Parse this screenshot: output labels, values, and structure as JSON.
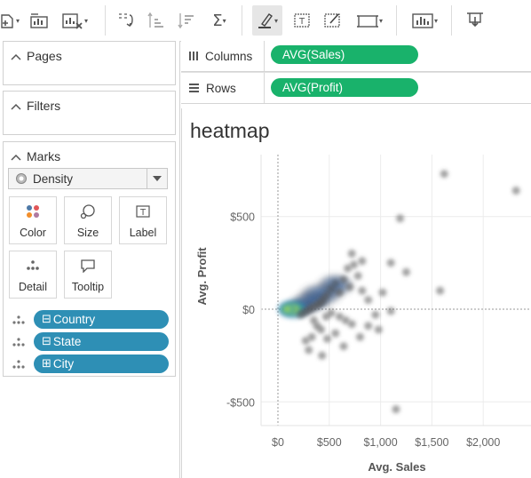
{
  "toolbar": {
    "icons": [
      "new-sheet-icon",
      "chart-icon",
      "clear-sheet-icon",
      "swap-icon",
      "sort-asc-icon",
      "sort-desc-icon",
      "totals-icon",
      "highlight-icon",
      "label-icon",
      "annotate-icon",
      "fit-icon",
      "show-me-icon",
      "presentation-icon"
    ]
  },
  "left_panel": {
    "pages_title": "Pages",
    "filters_title": "Filters",
    "marks_title": "Marks",
    "mark_type": "Density",
    "mark_buttons": [
      "Color",
      "Size",
      "Label",
      "Detail",
      "Tooltip"
    ],
    "detail_fields": [
      {
        "toggle": "⊟",
        "label": "Country"
      },
      {
        "toggle": "⊟",
        "label": "State"
      },
      {
        "toggle": "⊞",
        "label": "City"
      }
    ]
  },
  "shelves": {
    "columns_label": "Columns",
    "columns_pill": "AVG(Sales)",
    "rows_label": "Rows",
    "rows_pill": "AVG(Profit)"
  },
  "chart_data": {
    "type": "scatter",
    "title": "heatmap",
    "xlabel": "Avg. Sales",
    "ylabel": "Avg. Profit",
    "x_ticks": [
      "$0",
      "$500",
      "$1,000",
      "$1,500",
      "$2,000"
    ],
    "y_ticks": [
      "$500",
      "$0",
      "-$500"
    ],
    "xlim": [
      -150,
      2450
    ],
    "ylim": [
      -620,
      830
    ],
    "colors": {
      "density_low": "#2c6fbb",
      "density_mid": "#2aa58a",
      "density_high": "#f2f21a",
      "outlier": "#555555"
    },
    "points": [
      [
        1620,
        730
      ],
      [
        2320,
        640
      ],
      [
        1190,
        490
      ],
      [
        1100,
        250
      ],
      [
        1250,
        200
      ],
      [
        1580,
        100
      ],
      [
        820,
        260
      ],
      [
        720,
        300
      ],
      [
        740,
        240
      ],
      [
        680,
        220
      ],
      [
        780,
        180
      ],
      [
        640,
        160
      ],
      [
        700,
        120
      ],
      [
        820,
        100
      ],
      [
        600,
        90
      ],
      [
        560,
        140
      ],
      [
        520,
        110
      ],
      [
        480,
        80
      ],
      [
        450,
        60
      ],
      [
        430,
        40
      ],
      [
        400,
        30
      ],
      [
        380,
        20
      ],
      [
        340,
        10
      ],
      [
        310,
        0
      ],
      [
        280,
        -10
      ],
      [
        250,
        -20
      ],
      [
        220,
        -30
      ],
      [
        520,
        -20
      ],
      [
        600,
        -40
      ],
      [
        660,
        -60
      ],
      [
        720,
        -80
      ],
      [
        800,
        -150
      ],
      [
        640,
        -200
      ],
      [
        480,
        -160
      ],
      [
        420,
        -110
      ],
      [
        380,
        -90
      ],
      [
        330,
        -150
      ],
      [
        300,
        -220
      ],
      [
        270,
        -170
      ],
      [
        430,
        -250
      ],
      [
        880,
        -90
      ],
      [
        950,
        -30
      ],
      [
        1100,
        -10
      ],
      [
        1150,
        -540
      ],
      [
        980,
        -110
      ],
      [
        560,
        -130
      ],
      [
        350,
        -60
      ],
      [
        470,
        -40
      ],
      [
        880,
        50
      ],
      [
        1020,
        90
      ]
    ]
  }
}
